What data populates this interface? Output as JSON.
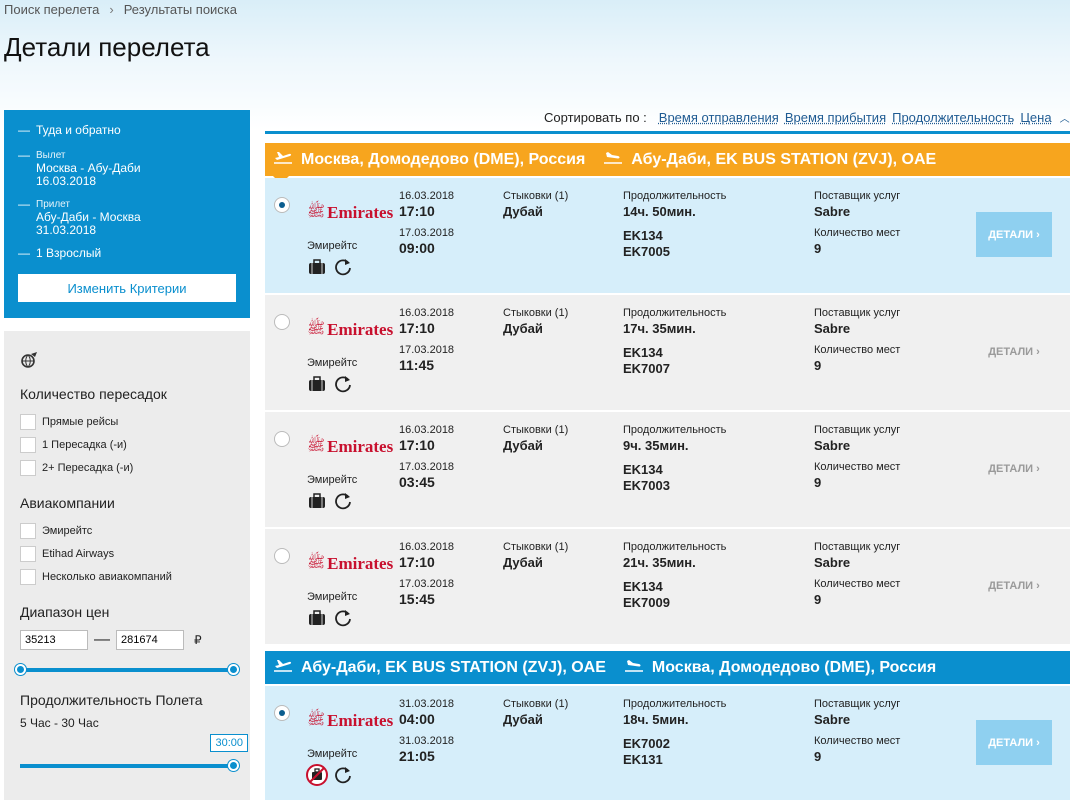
{
  "breadcrumb": [
    "Поиск перелета",
    "Результаты поиска"
  ],
  "breadcrumb_sep": "›",
  "page_title": "Детали перелета",
  "summary": {
    "trip_type": "Туда и обратно",
    "depart_label": "Вылет",
    "depart_route": "Москва - Абу-Даби",
    "depart_date": "16.03.2018",
    "return_label": "Прилет",
    "return_route": "Абу-Даби - Москва",
    "return_date": "31.03.2018",
    "passengers": "1 Взрослый",
    "change_button": "Изменить Критерии"
  },
  "filters": {
    "icon": "globe-plane-icon",
    "stops_title": "Количество пересадок",
    "stops": [
      "Прямые рейсы",
      "1 Пересадка (-и)",
      "2+ Пересадка (-и)"
    ],
    "airlines_title": "Авиакомпании",
    "airlines": [
      "Эмирейтс",
      "Etihad Airways",
      "Несколько авиакомпаний"
    ],
    "price_title": "Диапазон цен",
    "price_min": "35213",
    "price_max": "281674",
    "price_dash": "—",
    "currency": "₽",
    "duration_title": "Продолжительность Полета",
    "duration_range": "5 Час - 30 Час",
    "duration_tooltip": "30:00"
  },
  "sort": {
    "label": "Сортировать по :",
    "options": [
      "Время отправления",
      "Время прибытия",
      "Продолжительность",
      "Цена"
    ]
  },
  "colors": {
    "accent": "#0a8fce",
    "orange": "#f7a51e",
    "brand_red": "#c8102e"
  },
  "outbound": {
    "from": "Москва, Домодедово (DME), Россия",
    "to": "Абу-Даби, EK BUS STATION (ZVJ), OAE",
    "icon": "plane-depart-icon"
  },
  "inbound": {
    "from": "Абу-Даби, EK BUS STATION (ZVJ), OAE",
    "to": "Москва, Домодедово (DME), Россия",
    "icon": "plane-arrive-icon"
  },
  "labels": {
    "stops": "Стыковки (1)",
    "duration": "Продолжительность",
    "provider": "Поставщик услуг",
    "seats": "Количество мест",
    "details": "ДЕТАЛИ ›",
    "airline_name": "Эмирейтс",
    "logo_text": "Emirates"
  },
  "flights": [
    {
      "selected": true,
      "dep_date": "16.03.2018",
      "dep_time": "17:10",
      "arr_date": "17.03.2018",
      "arr_time": "09:00",
      "via": "Дубай",
      "duration": "14ч. 50мин.",
      "flight1": "EK134",
      "flight2": "EK7005",
      "provider": "Sabre",
      "seats": "9"
    },
    {
      "selected": false,
      "dep_date": "16.03.2018",
      "dep_time": "17:10",
      "arr_date": "17.03.2018",
      "arr_time": "11:45",
      "via": "Дубай",
      "duration": "17ч. 35мин.",
      "flight1": "EK134",
      "flight2": "EK7007",
      "provider": "Sabre",
      "seats": "9"
    },
    {
      "selected": false,
      "dep_date": "16.03.2018",
      "dep_time": "17:10",
      "arr_date": "17.03.2018",
      "arr_time": "03:45",
      "via": "Дубай",
      "duration": "9ч. 35мин.",
      "flight1": "EK134",
      "flight2": "EK7003",
      "provider": "Sabre",
      "seats": "9"
    },
    {
      "selected": false,
      "dep_date": "16.03.2018",
      "dep_time": "17:10",
      "arr_date": "17.03.2018",
      "arr_time": "15:45",
      "via": "Дубай",
      "duration": "21ч. 35мин.",
      "flight1": "EK134",
      "flight2": "EK7009",
      "provider": "Sabre",
      "seats": "9"
    },
    {
      "selected": true,
      "dep_date": "31.03.2018",
      "dep_time": "04:00",
      "arr_date": "31.03.2018",
      "arr_time": "21:05",
      "via": "Дубай",
      "duration": "18ч. 5мин.",
      "flight1": "EK7002",
      "flight2": "EK131",
      "provider": "Sabre",
      "seats": "9",
      "no_baggage": true
    }
  ]
}
